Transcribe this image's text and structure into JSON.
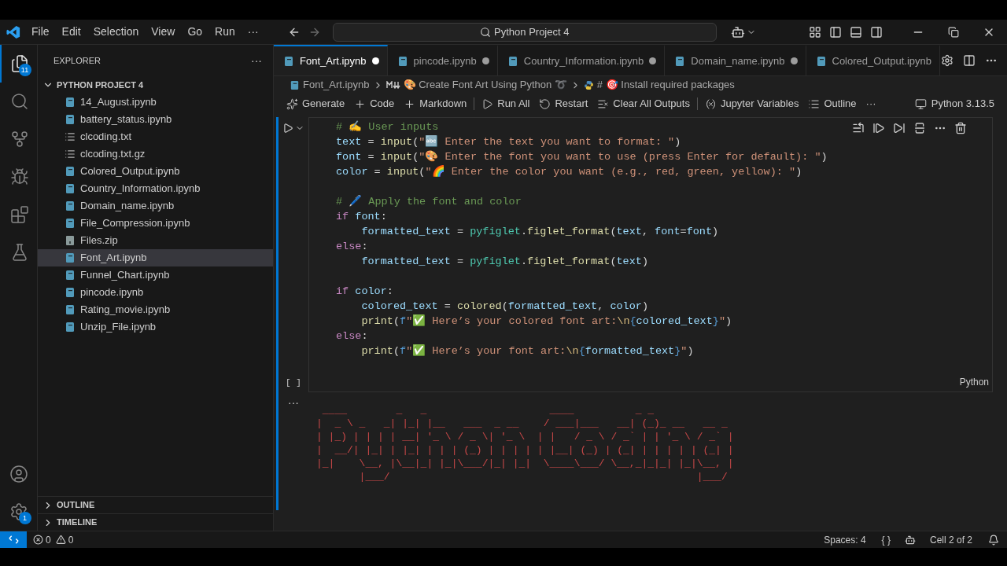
{
  "title_bar": {
    "menu": [
      "File",
      "Edit",
      "Selection",
      "View",
      "Go",
      "Run",
      "···"
    ],
    "search": "Python Project 4"
  },
  "activity_bar": {
    "items": [
      {
        "selected": true,
        "badge": "11"
      },
      {
        "selected": false
      },
      {
        "selected": false
      },
      {
        "selected": false
      },
      {
        "selected": false
      },
      {
        "selected": false
      }
    ],
    "settings_badge": "1"
  },
  "sidebar": {
    "title": "EXPLORER",
    "more": "···",
    "folder": {
      "name": "PYTHON PROJECT 4",
      "expanded": true,
      "files": [
        {
          "name": "14_August.ipynb",
          "kind": "notebook",
          "selected": false
        },
        {
          "name": "battery_status.ipynb",
          "kind": "notebook",
          "selected": false
        },
        {
          "name": "clcoding.txt",
          "kind": "text",
          "selected": false
        },
        {
          "name": "clcoding.txt.gz",
          "kind": "text",
          "selected": false
        },
        {
          "name": "Colored_Output.ipynb",
          "kind": "notebook",
          "selected": false
        },
        {
          "name": "Country_Information.ipynb",
          "kind": "notebook",
          "selected": false
        },
        {
          "name": "Domain_name.ipynb",
          "kind": "notebook",
          "selected": false
        },
        {
          "name": "File_Compression.ipynb",
          "kind": "notebook",
          "selected": false
        },
        {
          "name": "Files.zip",
          "kind": "zip",
          "selected": false
        },
        {
          "name": "Font_Art.ipynb",
          "kind": "notebook",
          "selected": true
        },
        {
          "name": "Funnel_Chart.ipynb",
          "kind": "notebook",
          "selected": false
        },
        {
          "name": "pincode.ipynb",
          "kind": "notebook",
          "selected": false
        },
        {
          "name": "Rating_movie.ipynb",
          "kind": "notebook",
          "selected": false
        },
        {
          "name": "Unzip_File.ipynb",
          "kind": "notebook",
          "selected": false
        }
      ]
    },
    "sections": [
      {
        "name": "OUTLINE",
        "expanded": false
      },
      {
        "name": "TIMELINE",
        "expanded": false
      }
    ]
  },
  "tabs": [
    {
      "label": "Font_Art.ipynb",
      "selected": true,
      "modified": true
    },
    {
      "label": "pincode.ipynb",
      "selected": false,
      "modified": true
    },
    {
      "label": "Country_Information.ipynb",
      "selected": false,
      "modified": true
    },
    {
      "label": "Domain_name.ipynb",
      "selected": false,
      "modified": true
    },
    {
      "label": "Colored_Output.ipynb",
      "selected": false,
      "modified": false
    }
  ],
  "breadcrumbs": [
    "Font_Art.ipynb",
    "🎨 Create Font Art Using Python ➰",
    "# 🎯 Install required packages"
  ],
  "notebook_toolbar": {
    "items": [
      "Generate",
      "Code",
      "Markdown",
      "Run All",
      "Restart",
      "Clear All Outputs",
      "Jupyter Variables",
      "Outline",
      "···"
    ],
    "kernel": "Python 3.13.5"
  },
  "cell": {
    "status": "[ ]",
    "language": "Python",
    "code": [
      [
        [
          {
            "kind": "comment",
            "text": "# ✍️ User inputs"
          }
        ],
        [
          {
            "kind": "variable",
            "text": "text"
          },
          {
            "kind": "operator",
            "text": " = "
          },
          {
            "kind": "function",
            "text": "input"
          },
          {
            "kind": "operator",
            "text": "("
          },
          {
            "kind": "string",
            "text": "\"🔤 Enter the text you want to format: \""
          },
          {
            "kind": "operator",
            "text": ")"
          }
        ],
        [
          {
            "kind": "variable",
            "text": "font"
          },
          {
            "kind": "operator",
            "text": " = "
          },
          {
            "kind": "function",
            "text": "input"
          },
          {
            "kind": "operator",
            "text": "("
          },
          {
            "kind": "string",
            "text": "\"🎨 Enter the font you want to use (press Enter for default): \""
          },
          {
            "kind": "operator",
            "text": ")"
          }
        ],
        [
          {
            "kind": "variable",
            "text": "color"
          },
          {
            "kind": "operator",
            "text": " = "
          },
          {
            "kind": "function",
            "text": "input"
          },
          {
            "kind": "operator",
            "text": "("
          },
          {
            "kind": "string",
            "text": "\"🌈 Enter the color you want (e.g., red, green, yellow): \""
          },
          {
            "kind": "operator",
            "text": ")"
          }
        ]
      ],
      [
        [
          {
            "kind": "comment",
            "text": "# 🖊️ Apply the font and color"
          }
        ],
        [
          {
            "kind": "keyword",
            "text": "if"
          },
          {
            "kind": "variable",
            "text": " font"
          },
          {
            "kind": "operator",
            "text": ":"
          }
        ],
        [
          {
            "kind": "variable",
            "text": "    formatted_text"
          },
          {
            "kind": "operator",
            "text": " = "
          },
          {
            "kind": "module",
            "text": "pyfiglet"
          },
          {
            "kind": "operator",
            "text": "."
          },
          {
            "kind": "function",
            "text": "figlet_format"
          },
          {
            "kind": "operator",
            "text": "("
          },
          {
            "kind": "variable",
            "text": "text"
          },
          {
            "kind": "operator",
            "text": ", "
          },
          {
            "kind": "variable",
            "text": "font"
          },
          {
            "kind": "operator",
            "text": "="
          },
          {
            "kind": "variable",
            "text": "font"
          },
          {
            "kind": "operator",
            "text": ")"
          }
        ],
        [
          {
            "kind": "keyword",
            "text": "else"
          },
          {
            "kind": "operator",
            "text": ":"
          }
        ],
        [
          {
            "kind": "variable",
            "text": "    formatted_text"
          },
          {
            "kind": "operator",
            "text": " = "
          },
          {
            "kind": "module",
            "text": "pyfiglet"
          },
          {
            "kind": "operator",
            "text": "."
          },
          {
            "kind": "function",
            "text": "figlet_format"
          },
          {
            "kind": "operator",
            "text": "("
          },
          {
            "kind": "variable",
            "text": "text"
          },
          {
            "kind": "operator",
            "text": ")"
          }
        ]
      ],
      [
        [
          {
            "kind": "keyword",
            "text": "if"
          },
          {
            "kind": "variable",
            "text": " color"
          },
          {
            "kind": "operator",
            "text": ":"
          }
        ],
        [
          {
            "kind": "variable",
            "text": "    colored_text"
          },
          {
            "kind": "operator",
            "text": " = "
          },
          {
            "kind": "function",
            "text": "colored"
          },
          {
            "kind": "operator",
            "text": "("
          },
          {
            "kind": "variable",
            "text": "formatted_text"
          },
          {
            "kind": "operator",
            "text": ", "
          },
          {
            "kind": "variable",
            "text": "color"
          },
          {
            "kind": "operator",
            "text": ")"
          }
        ],
        [
          {
            "kind": "function",
            "text": "    print"
          },
          {
            "kind": "operator",
            "text": "("
          },
          {
            "kind": "storage",
            "text": "f"
          },
          {
            "kind": "string",
            "text": "\"✅ Here’s your colored font art:"
          },
          {
            "kind": "escape",
            "text": "\\n"
          },
          {
            "kind": "storage",
            "text": "{"
          },
          {
            "kind": "variable",
            "text": "colored_text"
          },
          {
            "kind": "storage",
            "text": "}"
          },
          {
            "kind": "string",
            "text": "\""
          },
          {
            "kind": "operator",
            "text": ")"
          }
        ],
        [
          {
            "kind": "keyword",
            "text": "else"
          },
          {
            "kind": "operator",
            "text": ":"
          }
        ],
        [
          {
            "kind": "function",
            "text": "    print"
          },
          {
            "kind": "operator",
            "text": "("
          },
          {
            "kind": "storage",
            "text": "f"
          },
          {
            "kind": "string",
            "text": "\"✅ Here’s your font art:"
          },
          {
            "kind": "escape",
            "text": "\\n"
          },
          {
            "kind": "storage",
            "text": "{"
          },
          {
            "kind": "variable",
            "text": "formatted_text"
          },
          {
            "kind": "storage",
            "text": "}"
          },
          {
            "kind": "string",
            "text": "\""
          },
          {
            "kind": "operator",
            "text": ")"
          }
        ]
      ]
    ]
  },
  "output": {
    "more": "···",
    "lines": [
      " ____        _   _                    ____          _ _",
      "|  _ \\ _   _| |_| |__   ___  _ __    / ___|___   __| (_)_ __   __ _",
      "| |_) | | | | __| '_ \\ / _ \\| '_ \\  | |   / _ \\ / _` | | '_ \\ / _` |",
      "|  __/| |_| | |_| | | | (_) | | | | | |__| (_) | (_| | | | | | (_| |",
      "|_|    \\__, |\\__|_| |_|\\___/|_| |_|  \\____\\___/ \\__,_|_|_| |_|\\__, |",
      "       |___/                                                  |___/"
    ]
  },
  "status_bar": {
    "errors": "0",
    "warnings": "0",
    "spaces": "Spaces: 4",
    "braces": "{ }",
    "cell": "Cell 2 of 2"
  }
}
